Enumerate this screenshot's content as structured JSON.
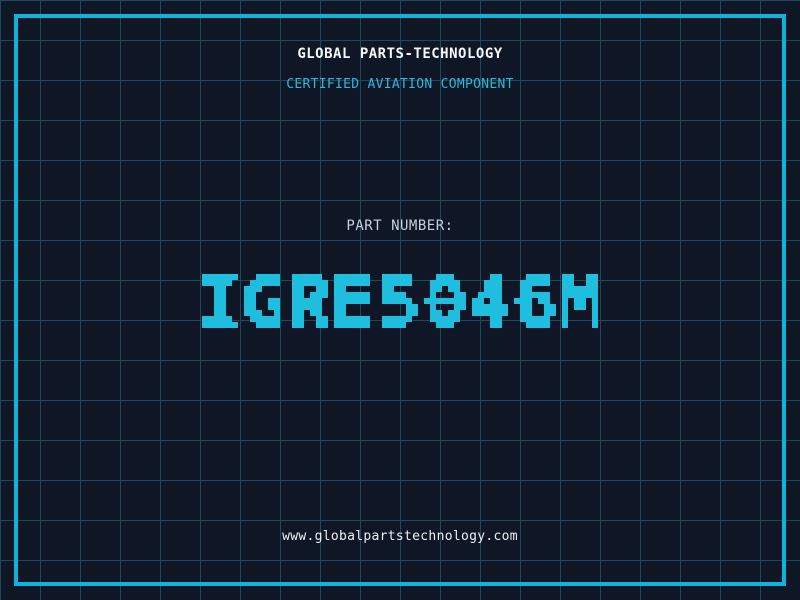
{
  "header": {
    "company_name": "GLOBAL PARTS-TECHNOLOGY",
    "tagline": "CERTIFIED AVIATION COMPONENT"
  },
  "part": {
    "label": "PART NUMBER:",
    "value": "IGRE5046M"
  },
  "footer": {
    "website": "www.globalpartstechnology.com"
  },
  "colors": {
    "background": "#0f1726",
    "grid_line": "#1b4a5f",
    "frame_border": "#0cb3da",
    "part_number_cyan": "#1fbedf",
    "tagline_cyan": "#2bb9dd",
    "title_white": "#f5f7fa",
    "label_gray": "#c9cfda",
    "url_white": "#eef1f6"
  }
}
